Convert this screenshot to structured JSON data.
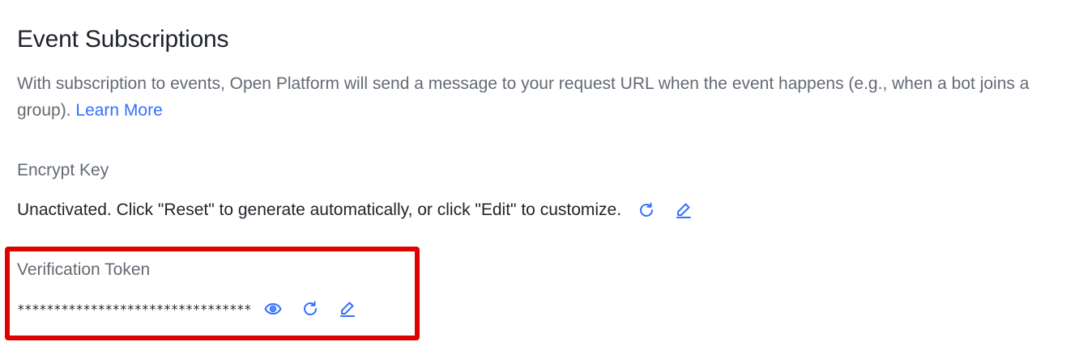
{
  "section": {
    "title": "Event Subscriptions",
    "description": "With subscription to events, Open Platform will send a message to your request URL when the event happens (e.g., when a bot joins a group).",
    "learn_more": "Learn More"
  },
  "encrypt_key": {
    "label": "Encrypt Key",
    "value": "Unactivated. Click \"Reset\" to generate automatically, or click \"Edit\" to customize.",
    "icons": [
      "reset-icon",
      "edit-icon"
    ]
  },
  "verification_token": {
    "label": "Verification Token",
    "value": "********************************",
    "icons": [
      "show-icon",
      "reset-icon",
      "edit-icon"
    ]
  },
  "colors": {
    "accent": "#3370ff",
    "highlight": "#e00000",
    "muted_text": "#646a73",
    "text": "#1f2329"
  }
}
